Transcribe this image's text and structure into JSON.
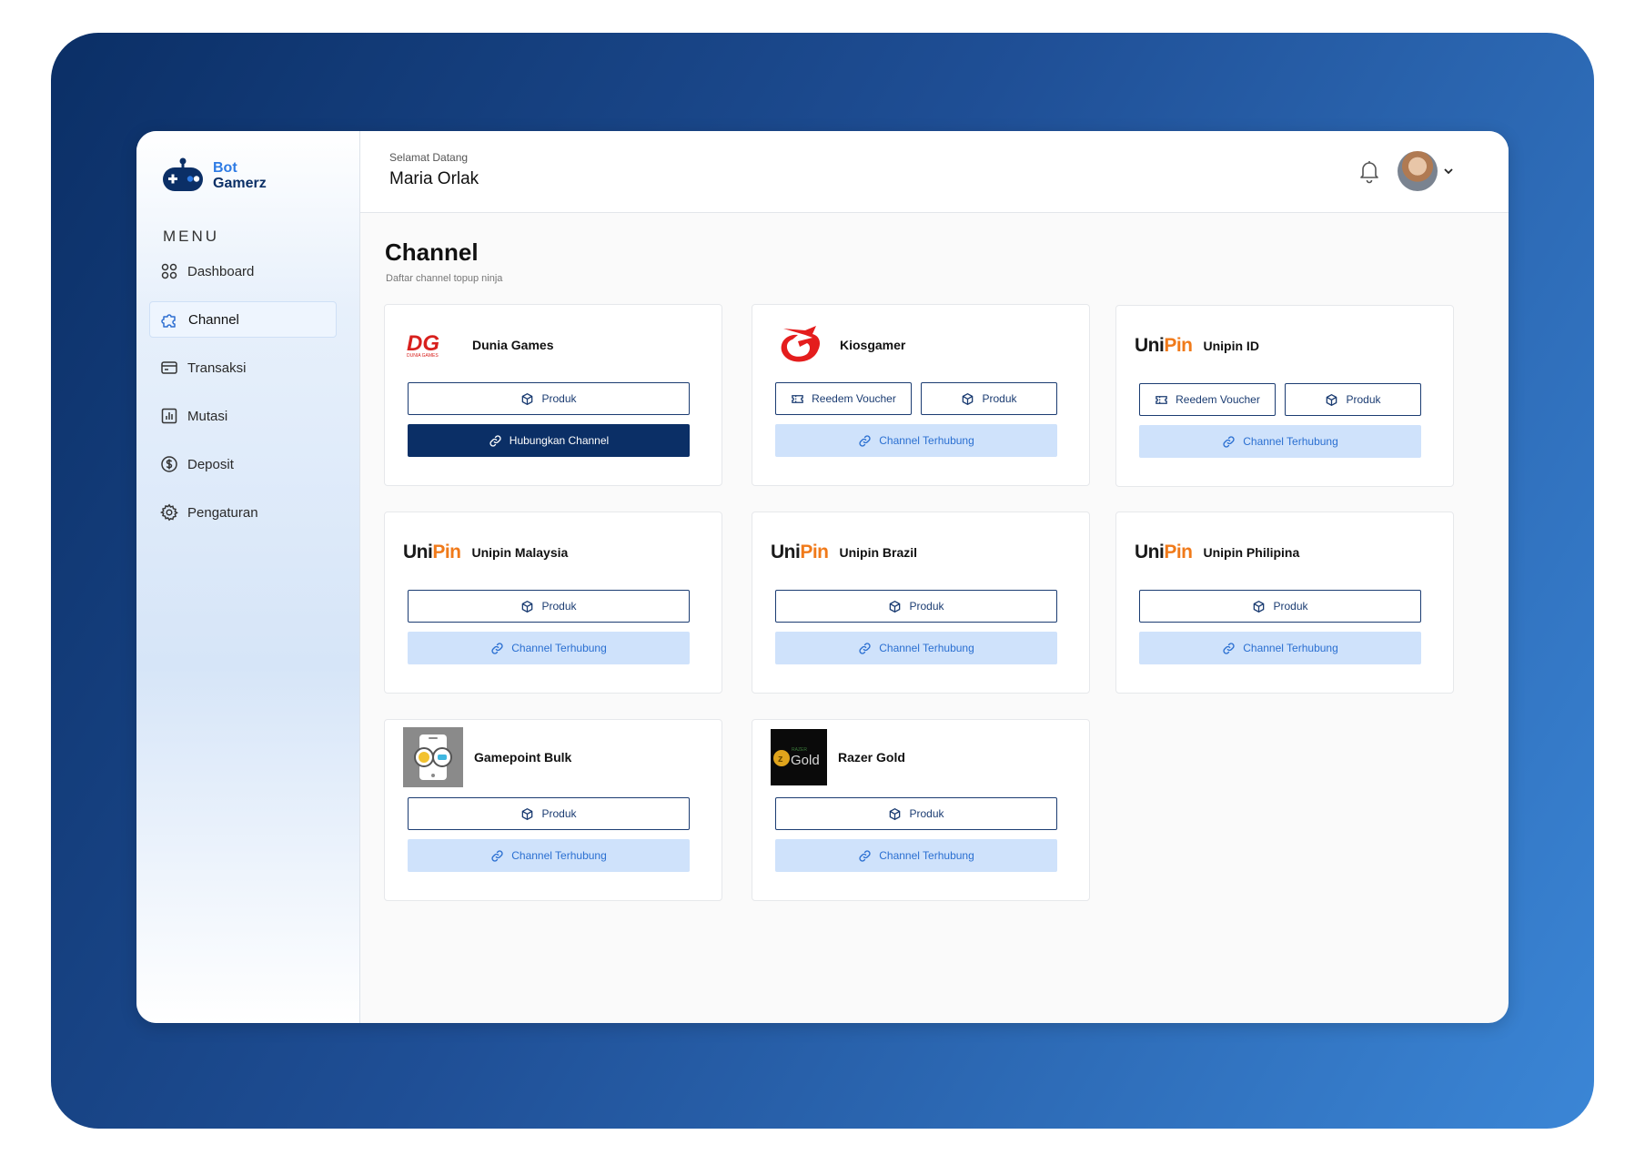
{
  "brand": {
    "line1": "Bot",
    "line2": "Gamerz"
  },
  "sidebar": {
    "menu_title": "MENU",
    "items": [
      {
        "label": "Dashboard",
        "icon": "grid-icon",
        "active": false
      },
      {
        "label": "Channel",
        "icon": "puzzle-icon",
        "active": true
      },
      {
        "label": "Transaksi",
        "icon": "card-icon",
        "active": false
      },
      {
        "label": "Mutasi",
        "icon": "chart-icon",
        "active": false
      },
      {
        "label": "Deposit",
        "icon": "dollar-icon",
        "active": false
      },
      {
        "label": "Pengaturan",
        "icon": "gear-icon",
        "active": false
      }
    ]
  },
  "header": {
    "greeting": "Selamat Datang",
    "user": "Maria Orlak"
  },
  "page": {
    "title": "Channel",
    "subtitle": "Daftar channel topup ninja"
  },
  "colors": {
    "primary": "#0b2f66",
    "accent": "#2e7be4",
    "connected_bg": "#cfe2fb",
    "unipin_orange": "#f07a1a"
  },
  "logos": {
    "dg": "DG",
    "dg_small": "DUNIA GAMES",
    "unipin_a": "Uni",
    "unipin_b": "Pin",
    "razer_small": "RAZER",
    "razer_gold": "Gold"
  },
  "channels": [
    {
      "name": "Dunia Games",
      "logo": "dg-logo",
      "buttons": {
        "produk": "Produk",
        "connect": "Hubungkan Channel"
      }
    },
    {
      "name": "Kiosgamer",
      "logo": "garena-logo",
      "buttons": {
        "voucher": "Reedem Voucher",
        "produk": "Produk",
        "connected": "Channel Terhubung"
      }
    },
    {
      "name": "Unipin ID",
      "logo": "unipin-logo",
      "buttons": {
        "voucher": "Reedem Voucher",
        "produk": "Produk",
        "connected": "Channel Terhubung"
      }
    },
    {
      "name": "Unipin Malaysia",
      "logo": "unipin-logo",
      "buttons": {
        "produk": "Produk",
        "connected": "Channel Terhubung"
      }
    },
    {
      "name": "Unipin Brazil",
      "logo": "unipin-logo",
      "buttons": {
        "produk": "Produk",
        "connected": "Channel Terhubung"
      }
    },
    {
      "name": "Unipin Philipina",
      "logo": "unipin-logo",
      "buttons": {
        "produk": "Produk",
        "connected": "Channel Terhubung"
      }
    },
    {
      "name": "Gamepoint Bulk",
      "logo": "gamepoint-logo",
      "buttons": {
        "produk": "Produk",
        "connected": "Channel Terhubung"
      }
    },
    {
      "name": "Razer Gold",
      "logo": "razer-gold-logo",
      "buttons": {
        "produk": "Produk",
        "connected": "Channel Terhubung"
      }
    }
  ]
}
